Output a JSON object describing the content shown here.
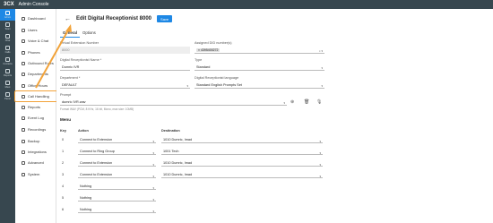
{
  "topbar": {
    "logo": "3CX",
    "title": "Admin Console"
  },
  "rail": [
    {
      "label": "Admin",
      "icon": "admin-icon"
    },
    {
      "label": "Team",
      "icon": "team-icon"
    },
    {
      "label": "Chat",
      "icon": "chat-icon"
    },
    {
      "label": "Calls",
      "icon": "calls-icon"
    },
    {
      "label": "Contacts",
      "icon": "contacts-icon"
    },
    {
      "label": "Reports",
      "icon": "reports-icon"
    },
    {
      "label": "Meet",
      "icon": "meet-icon"
    },
    {
      "label": "Panel",
      "icon": "panel-icon"
    }
  ],
  "side_menu": [
    {
      "label": "Dashboard",
      "icon": "dashboard-icon"
    },
    {
      "label": "Users",
      "icon": "users-icon"
    },
    {
      "label": "Voice & Chat",
      "icon": "voice-chat-icon"
    },
    {
      "label": "Phones",
      "icon": "phones-icon"
    },
    {
      "label": "Outbound Rules",
      "icon": "outbound-rules-icon"
    },
    {
      "label": "Departments",
      "icon": "departments-icon"
    },
    {
      "label": "Office Hours",
      "icon": "office-hours-icon"
    },
    {
      "label": "Call Handling",
      "icon": "call-handling-icon",
      "active": true
    },
    {
      "label": "Reports",
      "icon": "reports-icon"
    },
    {
      "label": "Event Log",
      "icon": "event-log-icon"
    },
    {
      "label": "Recordings",
      "icon": "recordings-icon"
    },
    {
      "label": "Backup",
      "icon": "backup-icon"
    },
    {
      "label": "Integrations",
      "icon": "integrations-icon"
    },
    {
      "label": "Advanced",
      "icon": "advanced-icon"
    },
    {
      "label": "System",
      "icon": "system-icon"
    }
  ],
  "header": {
    "back": "←",
    "title": "Edit Digital Receptionist 8000",
    "save": "Save"
  },
  "tabs": [
    "General",
    "Options"
  ],
  "form": {
    "virtual_ext_label": "Virtual Extension Number",
    "virtual_ext_value": "8000",
    "assigned_did_label": "Assigned DID number(s)",
    "assigned_did_value": "× 4395400272",
    "name_label": "Digital Receptionist Name *",
    "name_value": "Dumric IVR",
    "type_label": "Type",
    "type_value": "Standard",
    "dept_label": "Department *",
    "dept_value": "DEFAULT",
    "lang_label": "Digital Receptionist language",
    "lang_value": "Standard English Prompts Set",
    "prompt_label": "Prompt",
    "prompt_value": "dumric IVR.wav",
    "prompt_hint": "Format WAV (PCM, 8 KHz, 16 bit, Mono, max size: 10MB)"
  },
  "menu": {
    "title": "Menu",
    "col_key": "Key",
    "col_action": "Action",
    "col_destination": "Destination",
    "rows": [
      {
        "key": "0",
        "action": "Connect to Extension",
        "destination": "1010 Dumric, Imad"
      },
      {
        "key": "1",
        "action": "Connect to Ring Group",
        "destination": "1001 Tech"
      },
      {
        "key": "2",
        "action": "Connect to Extension",
        "destination": "1010 Dumric, Imad"
      },
      {
        "key": "3",
        "action": "Connect to Extension",
        "destination": "1010 Dumric, Imad"
      },
      {
        "key": "4",
        "action": "Nothing",
        "destination": ""
      },
      {
        "key": "5",
        "action": "Nothing",
        "destination": ""
      },
      {
        "key": "6",
        "action": "Nothing",
        "destination": ""
      }
    ]
  },
  "colors": {
    "accent": "#1e88e5",
    "highlight": "#f2a33a",
    "sidebar": "#37474f"
  }
}
